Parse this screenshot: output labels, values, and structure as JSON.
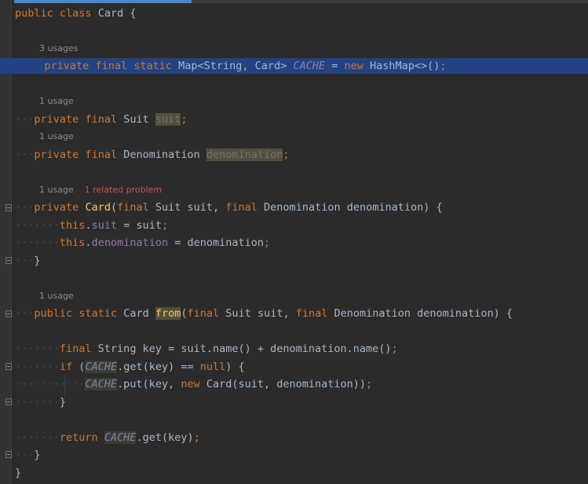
{
  "editor": {
    "lines": {
      "l1": [
        "public",
        " ",
        "class",
        " Card {"
      ],
      "hint1": "3 usages",
      "l2": {
        "a": "private",
        "b": " ",
        "c": "final",
        "d": " ",
        "e": "static",
        "f": " Map<String, Card> ",
        "g": "CACHE",
        "h": " = ",
        "i": "new",
        "j": " HashMap<>()",
        "k": ";"
      },
      "hint2": "1 usage",
      "l3": {
        "a": "private",
        "b": " ",
        "c": "final",
        "d": " Suit ",
        "e": "suit",
        "f": ";"
      },
      "hint3": "1 usage",
      "l4": {
        "a": "private",
        "b": " ",
        "c": "final",
        "d": " Denomination ",
        "e": "denomination",
        "f": ";"
      },
      "hint4": "1 usage",
      "hint4_problem": "1 related problem",
      "l5": {
        "a": "private",
        "b": " ",
        "c": "Card",
        "d": "(",
        "e": "final",
        "f": " Suit suit, ",
        "g": "final",
        "h": " Denomination denomination) {"
      },
      "l6": {
        "a": "this",
        "b": ".",
        "c": "suit",
        "d": " = suit",
        "e": ";"
      },
      "l7": {
        "a": "this",
        "b": ".",
        "c": "denomination",
        "d": " = denomination",
        "e": ";"
      },
      "l8": "}",
      "hint5": "1 usage",
      "l9": {
        "a": "public",
        "b": " ",
        "c": "static",
        "d": " Card ",
        "e": "from",
        "f": "(",
        "g": "final",
        "h": " Suit suit, ",
        "i": "final",
        "j": " Denomination denomination) {"
      },
      "l10": {
        "a": "final",
        "b": " String key = suit.name() + denomination.name()",
        "c": ";"
      },
      "l11": {
        "a": "if",
        "b": " (",
        "c": "CACHE",
        "d": ".get(key) == ",
        "e": "null",
        "f": ") {"
      },
      "l12": {
        "a": "CACHE",
        "b": ".put(key, ",
        "c": "new",
        "d": " Card(suit, denomination))",
        "e": ";"
      },
      "l13": "}",
      "l14": {
        "a": "return",
        "b": " ",
        "c": "CACHE",
        "d": ".get(key)",
        "e": ";"
      },
      "l15": "}",
      "l16": "}"
    },
    "colors": {
      "background": "#2b2b2b",
      "keyword": "#cc7832",
      "field": "#9876aa",
      "method": "#ffc66d",
      "selection": "#214283"
    }
  }
}
